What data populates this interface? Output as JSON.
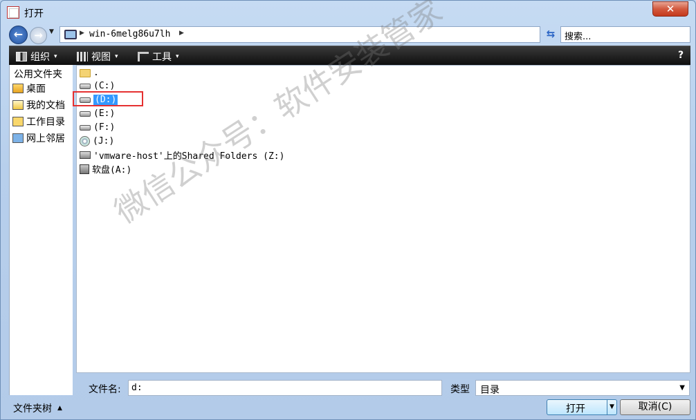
{
  "window": {
    "title": "打开",
    "close_label": "✕"
  },
  "address": {
    "path": "win-6melg86u7lh",
    "search_placeholder": "搜索..."
  },
  "toolbar": {
    "organize": "组织",
    "view": "视图",
    "tools": "工具"
  },
  "sidebar": {
    "header": "公用文件夹",
    "items": [
      {
        "label": "桌面",
        "icon": "desktop-icon"
      },
      {
        "label": "我的文档",
        "icon": "documents-icon"
      },
      {
        "label": "工作目录",
        "icon": "work-folder-icon"
      },
      {
        "label": "网上邻居",
        "icon": "network-icon"
      }
    ]
  },
  "files": [
    {
      "label": ".",
      "icon": "folder-icon"
    },
    {
      "label": "(C:)",
      "icon": "drive-icon"
    },
    {
      "label": "(D:)",
      "icon": "drive-icon",
      "selected": true
    },
    {
      "label": "(E:)",
      "icon": "drive-icon"
    },
    {
      "label": "(F:)",
      "icon": "drive-icon"
    },
    {
      "label": "(J:)",
      "icon": "cd-drive-icon"
    },
    {
      "label": "'vmware-host'上的Shared Folders (Z:)",
      "icon": "network-drive-icon"
    },
    {
      "label": "软盘(A:)",
      "icon": "floppy-icon"
    }
  ],
  "watermark": "微信公众号：软件安装管家",
  "footer": {
    "filename_label": "文件名:",
    "filename_value": "d:",
    "filetype_label": "类型",
    "filetype_value": "目录",
    "tree_toggle": "文件夹树",
    "open_label": "打开",
    "cancel_label": "取消(C)"
  }
}
